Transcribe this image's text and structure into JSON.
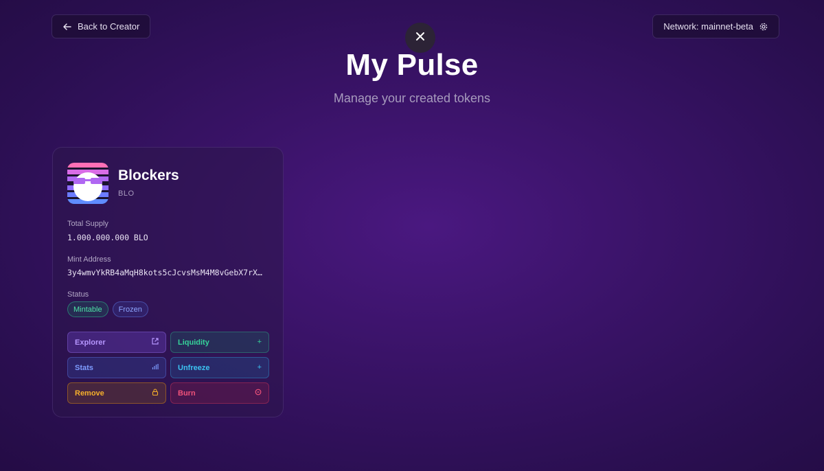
{
  "header": {
    "back_label": "Back to Creator",
    "network_label": "Network: mainnet-beta",
    "title": "My Pulse",
    "subtitle": "Manage your created tokens"
  },
  "token": {
    "name": "Blockers",
    "symbol": "BLO",
    "supply_label": "Total Supply",
    "supply_value": "1.000.000.000 BLO",
    "mint_label": "Mint Address",
    "mint_value": "3y4wmvYkRB4aMqH8kots5cJcvsMsM4M8vGebX7rX…",
    "status_label": "Status",
    "badges": [
      "Mintable",
      "Frozen"
    ],
    "actions": {
      "explorer": "Explorer",
      "liquidity": "Liquidity",
      "stats": "Stats",
      "unfreeze": "Unfreeze",
      "remove": "Remove",
      "burn": "Burn"
    }
  },
  "icons": {
    "back": "arrow-left-icon",
    "network": "gear-icon",
    "close": "close-icon",
    "explorer": "external-link-icon",
    "liquidity": "plus-icon",
    "stats": "bar-chart-icon",
    "unfreeze": "plus-icon",
    "remove": "lock-icon",
    "burn": "flame-icon"
  },
  "colors": {
    "background": "#3a1368",
    "mintable": "#4ee3a6",
    "frozen": "#8ea5ff"
  }
}
